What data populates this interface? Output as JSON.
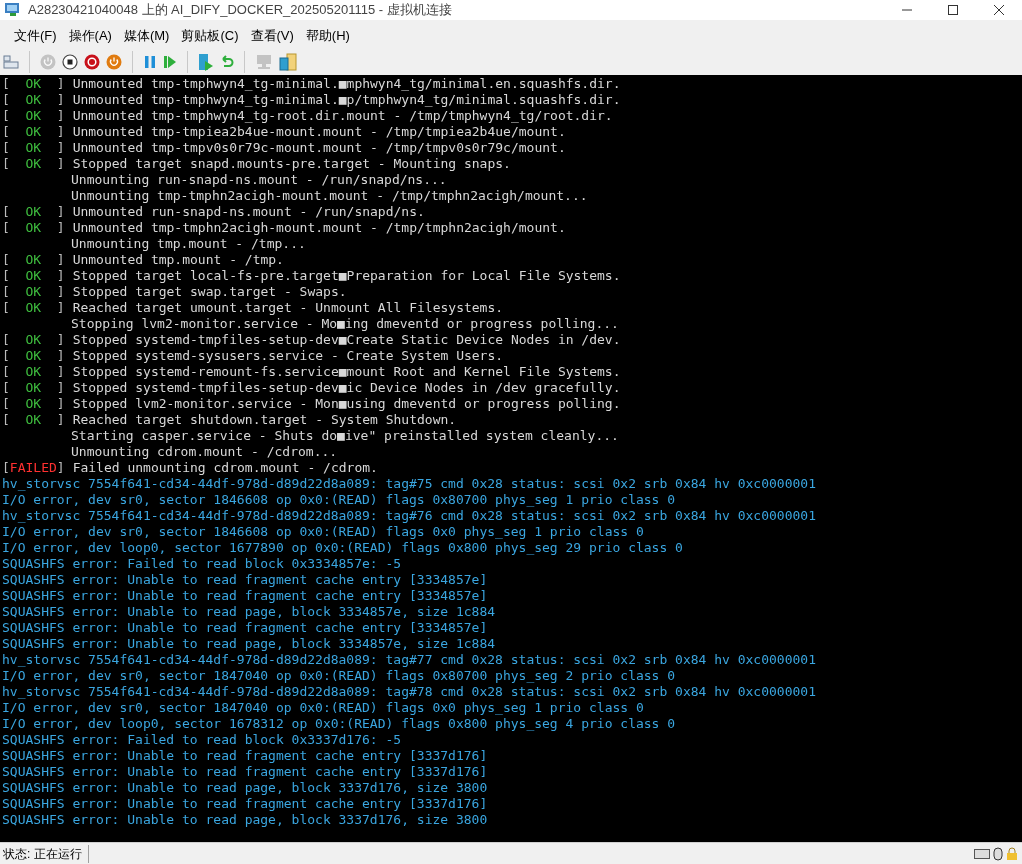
{
  "window": {
    "title": "A28230421040048 上的 AI_DIFY_DOCKER_202505201115 - 虚拟机连接"
  },
  "menu": [
    "文件(F)",
    "操作(A)",
    "媒体(M)",
    "剪贴板(C)",
    "查看(V)",
    "帮助(H)"
  ],
  "toolbar": [
    {
      "kind": "ctrl-alt-del",
      "disabled": false
    },
    {
      "kind": "sep"
    },
    {
      "kind": "start",
      "disabled": true
    },
    {
      "kind": "turn-off",
      "disabled": false
    },
    {
      "kind": "shut-down",
      "disabled": false
    },
    {
      "kind": "power",
      "disabled": false
    },
    {
      "kind": "sep"
    },
    {
      "kind": "pause",
      "disabled": false
    },
    {
      "kind": "resume",
      "disabled": false
    },
    {
      "kind": "sep"
    },
    {
      "kind": "checkpoint",
      "disabled": false
    },
    {
      "kind": "revert",
      "disabled": false
    },
    {
      "kind": "sep"
    },
    {
      "kind": "enhanced",
      "disabled": true
    },
    {
      "kind": "share",
      "disabled": false
    }
  ],
  "console": {
    "lines": [
      {
        "kind": "status",
        "status": "[  OK  ]",
        "color": "#3fbf3f",
        "text": "Unmounted tmp-tmphwyn4_tg-minimal.■mphwyn4_tg/minimal.en.squashfs.dir."
      },
      {
        "kind": "status",
        "status": "[  OK  ]",
        "color": "#3fbf3f",
        "text": "Unmounted tmp-tmphwyn4_tg-minimal.■p/tmphwyn4_tg/minimal.squashfs.dir."
      },
      {
        "kind": "status",
        "status": "[  OK  ]",
        "color": "#3fbf3f",
        "text": "Unmounted tmp-tmphwyn4_tg-root.dir.mount - /tmp/tmphwyn4_tg/root.dir."
      },
      {
        "kind": "status",
        "status": "[  OK  ]",
        "color": "#3fbf3f",
        "text": "Unmounted tmp-tmpiea2b4ue-mount.mount - /tmp/tmpiea2b4ue/mount."
      },
      {
        "kind": "status",
        "status": "[  OK  ]",
        "color": "#3fbf3f",
        "text": "Unmounted tmp-tmpv0s0r79c-mount.mount - /tmp/tmpv0s0r79c/mount."
      },
      {
        "kind": "status",
        "status": "[  OK  ]",
        "color": "#3fbf3f",
        "text": "Stopped target snapd.mounts-pre.target - Mounting snaps."
      },
      {
        "kind": "plain",
        "text": "Unmounting run-snapd-ns.mount - /run/snapd/ns..."
      },
      {
        "kind": "plain",
        "text": "Unmounting tmp-tmphn2acigh-mount.mount - /tmp/tmphn2acigh/mount..."
      },
      {
        "kind": "status",
        "status": "[  OK  ]",
        "color": "#3fbf3f",
        "text": "Unmounted run-snapd-ns.mount - /run/snapd/ns."
      },
      {
        "kind": "status",
        "status": "[  OK  ]",
        "color": "#3fbf3f",
        "text": "Unmounted tmp-tmphn2acigh-mount.mount - /tmp/tmphn2acigh/mount."
      },
      {
        "kind": "plain",
        "text": "Unmounting tmp.mount - /tmp..."
      },
      {
        "kind": "status",
        "status": "[  OK  ]",
        "color": "#3fbf3f",
        "text": "Unmounted tmp.mount - /tmp."
      },
      {
        "kind": "status",
        "status": "[  OK  ]",
        "color": "#3fbf3f",
        "text": "Stopped target local-fs-pre.target■Preparation for Local File Systems."
      },
      {
        "kind": "status",
        "status": "[  OK  ]",
        "color": "#3fbf3f",
        "text": "Stopped target swap.target - Swaps."
      },
      {
        "kind": "status",
        "status": "[  OK  ]",
        "color": "#3fbf3f",
        "text": "Reached target umount.target - Unmount All Filesystems."
      },
      {
        "kind": "plain",
        "text": "Stopping lvm2-monitor.service - Mo■ing dmeventd or progress polling..."
      },
      {
        "kind": "status",
        "status": "[  OK  ]",
        "color": "#3fbf3f",
        "text": "Stopped systemd-tmpfiles-setup-dev■Create Static Device Nodes in /dev."
      },
      {
        "kind": "status",
        "status": "[  OK  ]",
        "color": "#3fbf3f",
        "text": "Stopped systemd-sysusers.service - Create System Users."
      },
      {
        "kind": "status",
        "status": "[  OK  ]",
        "color": "#3fbf3f",
        "text": "Stopped systemd-remount-fs.service■mount Root and Kernel File Systems."
      },
      {
        "kind": "status",
        "status": "[  OK  ]",
        "color": "#3fbf3f",
        "text": "Stopped systemd-tmpfiles-setup-dev■ic Device Nodes in /dev gracefully."
      },
      {
        "kind": "status",
        "status": "[  OK  ]",
        "color": "#3fbf3f",
        "text": "Stopped lvm2-monitor.service - Mon■using dmeventd or progress polling."
      },
      {
        "kind": "status",
        "status": "[  OK  ]",
        "color": "#3fbf3f",
        "text": "Reached target shutdown.target - System Shutdown."
      },
      {
        "kind": "plain",
        "text": "Starting casper.service - Shuts do■ive\" preinstalled system cleanly..."
      },
      {
        "kind": "plain",
        "text": "Unmounting cdrom.mount - /cdrom..."
      },
      {
        "kind": "status",
        "status": "[FAILED]",
        "color": "#ff3030",
        "text": "Failed unmounting cdrom.mount - /cdrom."
      },
      {
        "kind": "kernel",
        "text": "hv_storvsc 7554f641-cd34-44df-978d-d89d22d8a089: tag#75 cmd 0x28 status: scsi 0x2 srb 0x84 hv 0xc0000001"
      },
      {
        "kind": "kernel",
        "text": "I/O error, dev sr0, sector 1846608 op 0x0:(READ) flags 0x80700 phys_seg 1 prio class 0"
      },
      {
        "kind": "kernel",
        "text": "hv_storvsc 7554f641-cd34-44df-978d-d89d22d8a089: tag#76 cmd 0x28 status: scsi 0x2 srb 0x84 hv 0xc0000001"
      },
      {
        "kind": "kernel",
        "text": "I/O error, dev sr0, sector 1846608 op 0x0:(READ) flags 0x0 phys_seg 1 prio class 0"
      },
      {
        "kind": "kernel",
        "text": "I/O error, dev loop0, sector 1677890 op 0x0:(READ) flags 0x800 phys_seg 29 prio class 0"
      },
      {
        "kind": "kernel",
        "text": "SQUASHFS error: Failed to read block 0x3334857e: -5"
      },
      {
        "kind": "kernel",
        "text": "SQUASHFS error: Unable to read fragment cache entry [3334857e]"
      },
      {
        "kind": "kernel",
        "text": "SQUASHFS error: Unable to read fragment cache entry [3334857e]"
      },
      {
        "kind": "kernel",
        "text": "SQUASHFS error: Unable to read page, block 3334857e, size 1c884"
      },
      {
        "kind": "kernel",
        "text": "SQUASHFS error: Unable to read fragment cache entry [3334857e]"
      },
      {
        "kind": "kernel",
        "text": "SQUASHFS error: Unable to read page, block 3334857e, size 1c884"
      },
      {
        "kind": "kernel",
        "text": "hv_storvsc 7554f641-cd34-44df-978d-d89d22d8a089: tag#77 cmd 0x28 status: scsi 0x2 srb 0x84 hv 0xc0000001"
      },
      {
        "kind": "kernel",
        "text": "I/O error, dev sr0, sector 1847040 op 0x0:(READ) flags 0x80700 phys_seg 2 prio class 0"
      },
      {
        "kind": "kernel",
        "text": "hv_storvsc 7554f641-cd34-44df-978d-d89d22d8a089: tag#78 cmd 0x28 status: scsi 0x2 srb 0x84 hv 0xc0000001"
      },
      {
        "kind": "kernel",
        "text": "I/O error, dev sr0, sector 1847040 op 0x0:(READ) flags 0x0 phys_seg 1 prio class 0"
      },
      {
        "kind": "kernel",
        "text": "I/O error, dev loop0, sector 1678312 op 0x0:(READ) flags 0x800 phys_seg 4 prio class 0"
      },
      {
        "kind": "kernel",
        "text": "SQUASHFS error: Failed to read block 0x3337d176: -5"
      },
      {
        "kind": "kernel",
        "text": "SQUASHFS error: Unable to read fragment cache entry [3337d176]"
      },
      {
        "kind": "kernel",
        "text": "SQUASHFS error: Unable to read fragment cache entry [3337d176]"
      },
      {
        "kind": "kernel",
        "text": "SQUASHFS error: Unable to read page, block 3337d176, size 3800"
      },
      {
        "kind": "kernel",
        "text": "SQUASHFS error: Unable to read fragment cache entry [3337d176]"
      },
      {
        "kind": "kernel",
        "text": "SQUASHFS error: Unable to read page, block 3337d176, size 3800"
      }
    ]
  },
  "status_bar": {
    "text": "状态: 正在运行"
  }
}
